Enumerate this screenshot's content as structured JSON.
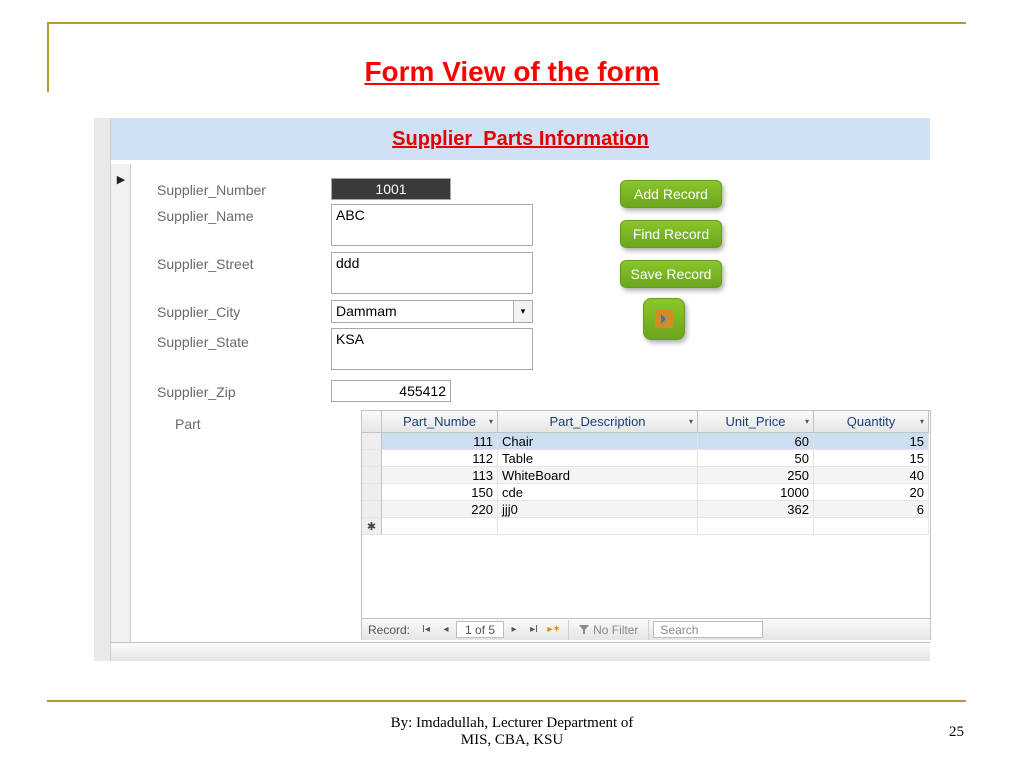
{
  "slide": {
    "title": "Form View of the form",
    "footer1": "By: Imdadullah, Lecturer Department of",
    "footer2": "MIS, CBA, KSU",
    "page": "25"
  },
  "form": {
    "header": "Supplier_Parts Information",
    "labels": {
      "number": "Supplier_Number",
      "name": "Supplier_Name",
      "street": "Supplier_Street",
      "city": "Supplier_City",
      "state": "Supplier_State",
      "zip": "Supplier_Zip",
      "part": "Part"
    },
    "values": {
      "number": "1001",
      "name": "ABC",
      "street": "ddd",
      "city": "Dammam",
      "state": "KSA",
      "zip": "455412"
    }
  },
  "buttons": {
    "add": "Add Record",
    "find": "Find Record",
    "save": "Save Record"
  },
  "grid": {
    "headers": {
      "partnum": "Part_Numbe",
      "desc": "Part_Description",
      "price": "Unit_Price",
      "qty": "Quantity"
    },
    "rows": [
      {
        "num": "111",
        "desc": "Chair",
        "price": "60",
        "qty": "15",
        "sel": true
      },
      {
        "num": "112",
        "desc": "Table",
        "price": "50",
        "qty": "15"
      },
      {
        "num": "113",
        "desc": "WhiteBoard",
        "price": "250",
        "qty": "40",
        "alt": true
      },
      {
        "num": "150",
        "desc": "cde",
        "price": "1000",
        "qty": "20"
      },
      {
        "num": "220",
        "desc": "jjj0",
        "price": "362",
        "qty": "6",
        "alt": true
      }
    ]
  },
  "nav": {
    "record_label": "Record:",
    "position": "1 of 5",
    "no_filter": "No Filter",
    "search": "Search"
  }
}
